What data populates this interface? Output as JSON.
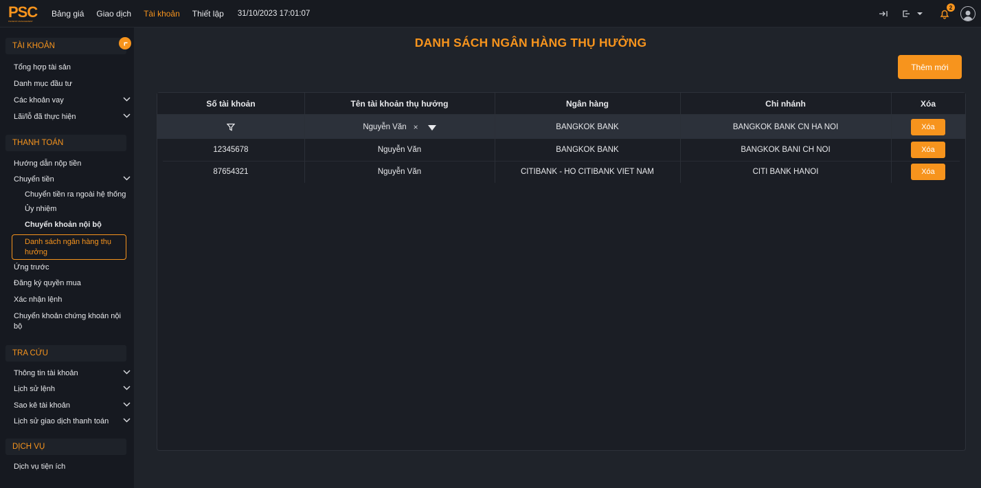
{
  "topbar": {
    "logo_text": "PSC",
    "logo_subtext": "PHOENIX MANAGEMENT",
    "nav": [
      "Bảng giá",
      "Giao dịch",
      "Tài khoản",
      "Thiết lập"
    ],
    "active_nav_index": 2,
    "datetime": "31/10/2023 17:01:07",
    "notification_count": "2"
  },
  "sidebar": {
    "sections": {
      "account": "TÀI KHOẢN",
      "payment": "THANH TOÁN",
      "lookup": "TRA CỨU",
      "service": "DỊCH VỤ"
    },
    "account_items": [
      "Tổng hợp tài sản",
      "Danh mục đầu tư",
      "Các khoản vay",
      "Lãi/lỗ đã thực hiện"
    ],
    "payment_items": {
      "deposit_guide": "Hướng dẫn nộp tiền",
      "transfer": "Chuyển tiền",
      "transfer_external": "Chuyển tiền ra ngoài hệ thống",
      "authorization": "Ủy nhiệm",
      "internal_transfer": "Chuyển khoản nội bộ",
      "beneficiary_banks": "Danh sách ngân hàng thụ hưởng",
      "advance": "Ứng trước",
      "rights_registration": "Đăng ký quyền mua",
      "order_confirmation": "Xác nhận lệnh",
      "securities_transfer": "Chuyển khoản chứng khoán nội bộ"
    },
    "lookup_items": [
      "Thông tin tài khoản",
      "Lịch sử lệnh",
      "Sao kê tài khoản",
      "Lịch sử giao dịch thanh toán"
    ],
    "service_items": [
      "Dịch vụ tiện ích"
    ]
  },
  "main": {
    "title": "DANH SÁCH NGÂN HÀNG THỤ HƯỞNG",
    "add_button": "Thêm mới",
    "columns": [
      "Số tài khoản",
      "Tên tài khoản thụ hưởng",
      "Ngân hàng",
      "Chi nhánh",
      "Xóa"
    ],
    "filter_row": {
      "account_name": "Nguyễn Văn",
      "clear": "×",
      "bank": "BANGKOK BANK",
      "branch": "BANGKOK BANK CN HA NOI",
      "delete": "Xóa"
    },
    "rows": [
      {
        "account_no": "12345678",
        "account_name": "Nguyễn Văn",
        "bank": "BANGKOK BANK",
        "branch": "BANGKOK BANI CH NOI",
        "delete": "Xóa"
      },
      {
        "account_no": "87654321",
        "account_name": "Nguyễn Văn",
        "bank": "CITIBANK - HO CITIBANK VIET NAM",
        "branch": "CITI BANK HANOI",
        "delete": "Xóa"
      }
    ]
  },
  "colors": {
    "accent": "#f7941d",
    "background": "#1f232a",
    "sidebar": "#161920",
    "filter_row": "#2c313a"
  }
}
